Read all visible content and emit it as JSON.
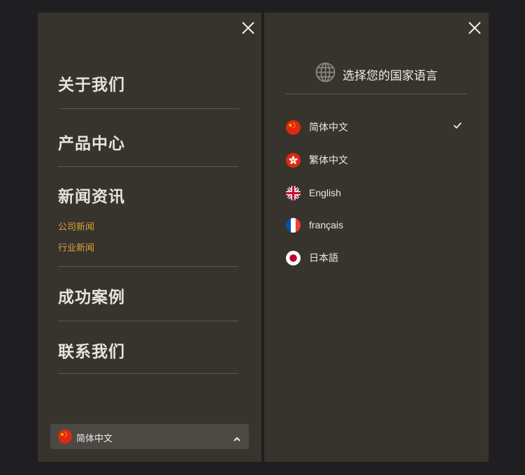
{
  "left_panel": {
    "close_icon": "close-icon",
    "nav_items": [
      {
        "label": "关于我们"
      },
      {
        "label": "产品中心"
      },
      {
        "label": "新闻资讯",
        "sub_items": [
          {
            "label": "公司新闻"
          },
          {
            "label": "行业新闻"
          }
        ]
      },
      {
        "label": "成功案例"
      },
      {
        "label": "联系我们"
      }
    ],
    "language_selector": {
      "label": "简体中文",
      "flag": "china-flag-icon",
      "chevron": "chevron-up-icon"
    }
  },
  "right_panel": {
    "close_icon": "close-icon",
    "title": "选择您的国家语言",
    "title_icon": "globe-icon",
    "languages": [
      {
        "label": "简体中文",
        "flag": "china-flag-icon",
        "selected": true
      },
      {
        "label": "繁体中文",
        "flag": "hong-kong-flag-icon",
        "selected": false
      },
      {
        "label": "English",
        "flag": "uk-flag-icon",
        "selected": false
      },
      {
        "label": "français",
        "flag": "france-flag-icon",
        "selected": false
      },
      {
        "label": "日本語",
        "flag": "japan-flag-icon",
        "selected": false
      }
    ]
  },
  "colors": {
    "background": "#1f1e21",
    "panel": "#37332d",
    "accent": "#d9a43c",
    "text": "#e6e3de"
  }
}
